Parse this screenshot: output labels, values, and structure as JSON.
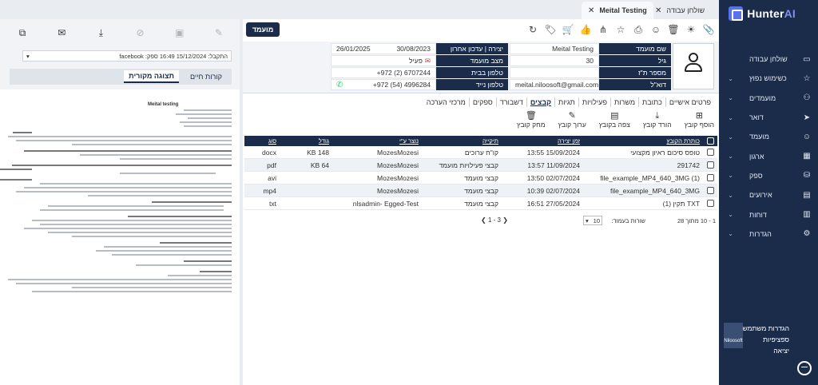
{
  "sidebar": {
    "brand": {
      "main": "Hunter",
      "accent": "AI"
    },
    "items": [
      {
        "label": "שולחן עבודה",
        "icon": "desk-icon",
        "chevron": false
      },
      {
        "label": "כשימוש נפוץ",
        "icon": "star-icon",
        "chevron": true
      },
      {
        "label": "מועמדים",
        "icon": "users-icon",
        "chevron": true
      },
      {
        "label": "דואר",
        "icon": "send-icon",
        "chevron": true
      },
      {
        "label": "מועמד",
        "icon": "person-icon",
        "chevron": true
      },
      {
        "label": "ארגון",
        "icon": "org-icon",
        "chevron": true
      },
      {
        "label": "ספק",
        "icon": "supplier-icon",
        "chevron": true
      },
      {
        "label": "אירועים",
        "icon": "calendar-icon",
        "chevron": true
      },
      {
        "label": "דוחות",
        "icon": "report-icon",
        "chevron": true
      },
      {
        "label": "הגדרות",
        "icon": "gear-icon",
        "chevron": true
      }
    ],
    "bottom_lines": [
      "הגדרות משתמש",
      "ספציפיות",
      "יציאה"
    ],
    "nilo_logo": "Niloosoft"
  },
  "top_tabs": [
    {
      "label": "שולחן עבודה",
      "active": false
    },
    {
      "label": "Meital Testing",
      "active": true
    }
  ],
  "main": {
    "meeting_button": "מועמד",
    "toolbar_icons": [
      "paperclip-icon",
      "lightbulb-icon",
      "trash-icon",
      "people-icon",
      "print-icon",
      "star-icon",
      "network-icon",
      "thumb-up-icon",
      "cart-icon",
      "tag-icon",
      "undo-icon"
    ],
    "info": {
      "name_label": "שם מועמד",
      "name_value": "Meital Testing",
      "age_label": "גיל",
      "age_value": "30",
      "id_label": "מספר ת\"ז",
      "id_value": "",
      "email_label": "דוא\"ל",
      "email_value": "meital.niloosoft@gmail.com",
      "created_label": "יצירה | עדכון אחרון",
      "created_value": "30/08/2023",
      "updated_value": "26/01/2025",
      "status_label": "מצב מועמד",
      "status_value": "פעיל",
      "home_label": "טלפון בבית",
      "home_value": "+972 (2) 6707244",
      "mobile_label": "טלפון נייד",
      "mobile_value": "+972 (54) 4996284"
    },
    "subtabs": [
      {
        "label": "פרטים אישיים",
        "active": false
      },
      {
        "label": "כתובת",
        "active": false
      },
      {
        "label": "משרות",
        "active": false
      },
      {
        "label": "פעילויות",
        "active": false
      },
      {
        "label": "תגיות",
        "active": false
      },
      {
        "label": "קבצים",
        "active": true
      },
      {
        "label": "דשבורד",
        "active": false
      },
      {
        "label": "ספקים",
        "active": false
      },
      {
        "label": "מרכזי הערכה",
        "active": false
      }
    ],
    "actions": [
      {
        "label": "הוסף קובץ",
        "icon": "file-add-icon"
      },
      {
        "label": "הורד קובץ",
        "icon": "download-icon"
      },
      {
        "label": "צפה בקובץ",
        "icon": "view-icon"
      },
      {
        "label": "ערוך קובץ",
        "icon": "edit-icon"
      },
      {
        "label": "מחק קובץ",
        "icon": "trash-icon"
      }
    ],
    "table": {
      "headers": {
        "name": "כותרת הקובץ",
        "date": "זמן יצירה",
        "note": "תיקייה",
        "by": "נוצר ע\"י",
        "size": "גודל",
        "type": "סוג"
      },
      "rows": [
        {
          "name": "טופס סיכום ראיון מקצועי",
          "date": "15/09/2024 13:55",
          "note": "קו\"ח ערוכים",
          "by": "MozesMozesi",
          "size": "148 KB",
          "type": "docx"
        },
        {
          "name": "291742",
          "date": "11/09/2024 13:57",
          "note": "קבצי פעילויות מועמד",
          "by": "MozesMozesi",
          "size": "64 KB",
          "type": "pdf"
        },
        {
          "name": "file_example_MP4_640_3MG (1)",
          "date": "02/07/2024 13:50",
          "note": "קבצי מועמד",
          "by": "MozesMozesi",
          "size": "",
          "type": "avi"
        },
        {
          "name": "file_example_MP4_640_3MG",
          "date": "02/07/2024 10:39",
          "note": "קבצי מועמד",
          "by": "MozesMozesi",
          "size": "",
          "type": "mp4"
        },
        {
          "name": "TXT תקין (1)",
          "date": "27/05/2024 16:51",
          "note": "קבצי מועמד",
          "by": "nlsadmin- Egged-Test",
          "size": "",
          "type": "txt"
        }
      ]
    },
    "pager": {
      "range": "1 - 10 מתוך 28",
      "per_page_label": "שורות בעמוד:",
      "per_page": "10",
      "pages": "1 - 3"
    }
  },
  "left": {
    "icons": [
      "copy-icon",
      "mail-icon",
      "download-icon",
      "block-icon",
      "save-icon",
      "edit-icon"
    ],
    "select_value": "התקבל: 15/12/2024 16:49 ספק: facebook",
    "tabs": [
      {
        "label": "קורות חיים",
        "active": false
      },
      {
        "label": "תצוגה מקורית",
        "active": true
      }
    ],
    "doc_name": "Meital testing"
  }
}
